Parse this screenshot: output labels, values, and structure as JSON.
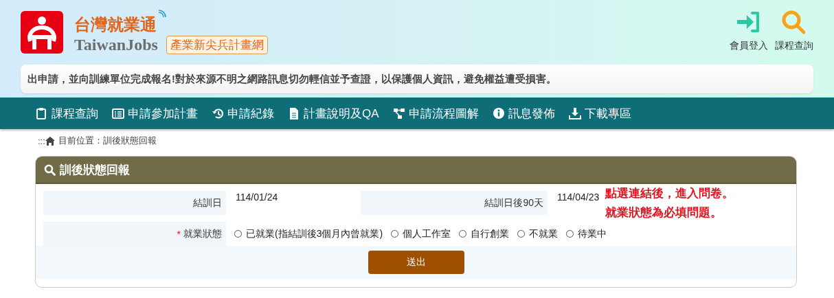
{
  "header": {
    "logo_title": "台灣就業通",
    "logo_subtitle": "TaiwanJobs",
    "site_badge": "產業新尖兵計畫網",
    "actions": [
      {
        "kind": "login",
        "label": "會員登入"
      },
      {
        "kind": "search",
        "label": "課程查詢"
      }
    ],
    "notice": "出申請，並向訓練單位完成報名!對於來源不明之網路訊息切勿輕信並予查證，以保護個人資訊，避免權益遭受損害。"
  },
  "nav": [
    {
      "kind": "clipboard",
      "label": "課程查詢"
    },
    {
      "kind": "list",
      "label": "申請參加計畫"
    },
    {
      "kind": "history",
      "label": "申請紀錄"
    },
    {
      "kind": "file",
      "label": "計畫說明及QA"
    },
    {
      "kind": "flow",
      "label": "申請流程圖解"
    },
    {
      "kind": "info",
      "label": "訊息發佈"
    },
    {
      "kind": "download",
      "label": "下載專區"
    }
  ],
  "breadcrumb": {
    "prefix": ":::",
    "text": "目前位置：訓後狀態回報"
  },
  "panel": {
    "title": "訓後狀態回報",
    "end_date": {
      "label": "結訓日",
      "value": "114/01/24"
    },
    "after_date": {
      "label": "結訓日後90天",
      "value": "114/04/23"
    },
    "note": [
      "點選連結後，進入問卷。",
      "就業狀態為必填問題。"
    ],
    "status": {
      "required_mark": "*",
      "label": "就業狀態",
      "options": [
        {
          "label": "已就業(指結訓後3個月內曾就業)",
          "selected": false
        },
        {
          "label": "個人工作室",
          "selected": false
        },
        {
          "label": "自行創業",
          "selected": false
        },
        {
          "label": "不就業",
          "selected": false
        },
        {
          "label": "待業中",
          "selected": false
        }
      ]
    },
    "submit": "送出"
  }
}
